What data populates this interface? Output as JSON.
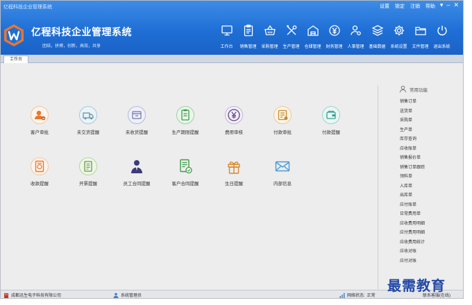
{
  "window": {
    "title": "亿程科技企业管理系统",
    "links": [
      "设置",
      "锁定",
      "注销",
      "帮助"
    ],
    "controls": [
      "▾",
      "–",
      "✕"
    ]
  },
  "brand": {
    "name": "亿程科技企业管理系统",
    "slogan": "团结，拼搏，创新，高效，共享"
  },
  "nav": [
    {
      "label": "工作台",
      "icon": "monitor-icon"
    },
    {
      "label": "销售管理",
      "icon": "clipboard-icon"
    },
    {
      "label": "采购管理",
      "icon": "basket-icon"
    },
    {
      "label": "生产管理",
      "icon": "tools-icon"
    },
    {
      "label": "仓储管理",
      "icon": "warehouse-icon"
    },
    {
      "label": "财务管理",
      "icon": "yen-icon"
    },
    {
      "label": "人事管理",
      "icon": "user-gear-icon"
    },
    {
      "label": "基础数据",
      "icon": "layers-icon"
    },
    {
      "label": "系统设置",
      "icon": "gear-icon"
    },
    {
      "label": "文件管理",
      "icon": "folder-icon"
    },
    {
      "label": "退出系统",
      "icon": "power-icon"
    }
  ],
  "tabs": [
    {
      "label": "工作台"
    }
  ],
  "shortcuts": [
    {
      "label": "客户审批",
      "icon": "customer-approval-icon"
    },
    {
      "label": "未交货提醒",
      "icon": "delivery-reminder-icon"
    },
    {
      "label": "未收货提醒",
      "icon": "receipt-reminder-icon"
    },
    {
      "label": "生产期限提醒",
      "icon": "production-deadline-icon"
    },
    {
      "label": "费用审核",
      "icon": "expense-audit-icon"
    },
    {
      "label": "付款审批",
      "icon": "payment-approval-icon"
    },
    {
      "label": "付款提醒",
      "icon": "payment-reminder-icon"
    },
    {
      "label": "收款提醒",
      "icon": "collection-reminder-icon"
    },
    {
      "label": "开票提醒",
      "icon": "invoice-reminder-icon"
    },
    {
      "label": "员工合同提醒",
      "icon": "employee-contract-icon"
    },
    {
      "label": "客户合同提醒",
      "icon": "customer-contract-icon"
    },
    {
      "label": "生日提醒",
      "icon": "gift-icon"
    },
    {
      "label": "内部信息",
      "icon": "mail-icon"
    }
  ],
  "common": {
    "title": "常用功能",
    "items": [
      "销售订单",
      "送货单",
      "采购单",
      "生产单",
      "库存查询",
      "应收账单",
      "销售报价单",
      "销售订单跟踪",
      "领料单",
      "入库单",
      "出库单",
      "应付账单",
      "日常费用单",
      "应收费用明细",
      "应付费用明细",
      "应收费用统计",
      "应收对账",
      "应付对账"
    ]
  },
  "status": {
    "company": "成都迅生电子科技有限公司",
    "user": "系统管理员",
    "network_label": "网络状态:",
    "network_value": "正常",
    "service": "联系客服(在线)"
  },
  "watermark": "最需教育",
  "colors": {
    "header": "#1f6fd6",
    "accent": "#e8772e"
  }
}
